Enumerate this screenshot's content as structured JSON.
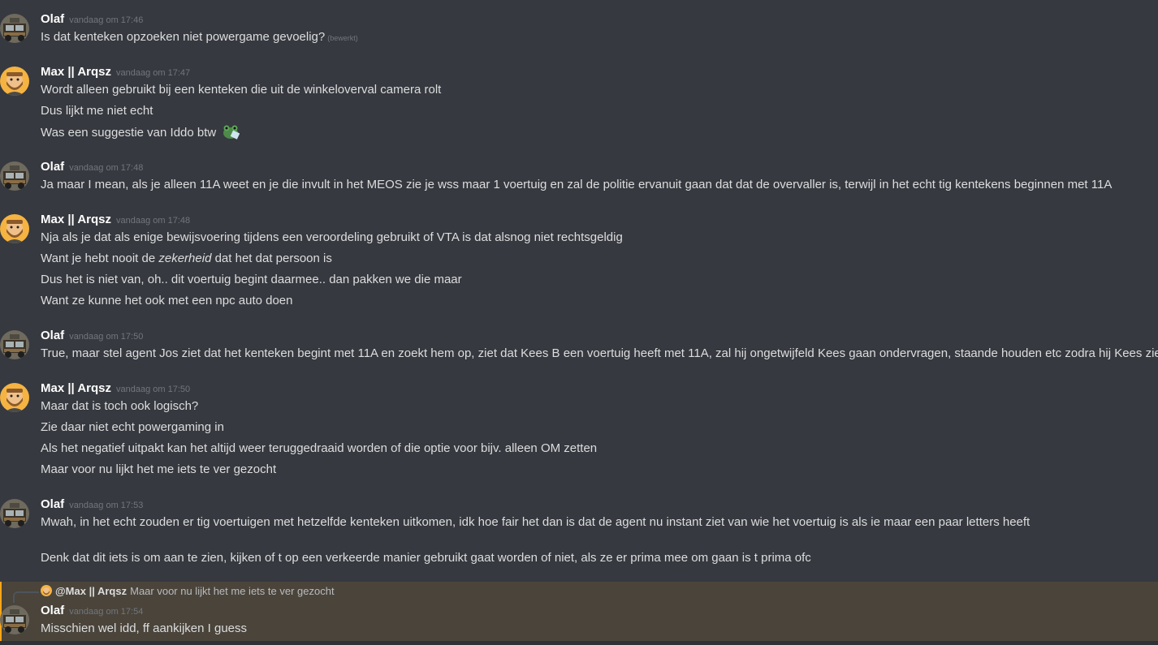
{
  "messages": [
    {
      "author": "Olaf",
      "time": "vandaag om 17:46",
      "lines": [
        "Is dat kenteken opzoeken niet powergame gevoelig?"
      ],
      "edited": "(bewerkt)"
    },
    {
      "author": "Max || Arqsz",
      "time": "vandaag om 17:47",
      "lines": [
        "Wordt alleen gebruikt bij een kenteken die uit de winkeloverval camera rolt",
        "Dus lijkt me niet echt",
        "Was een suggestie van Iddo btw"
      ]
    },
    {
      "author": "Olaf",
      "time": "vandaag om 17:48",
      "lines": [
        "Ja maar I mean, als je alleen 11A weet en je die invult in het MEOS zie je wss maar 1 voertuig en zal de politie ervanuit gaan dat dat de overvaller is, terwijl in het echt tig kentekens beginnen met 11A"
      ]
    },
    {
      "author": "Max || Arqsz",
      "time": "vandaag om 17:48",
      "lines": [
        "Nja als je dat als enige bewijsvoering tijdens een veroordeling gebruikt of VTA is dat alsnog niet rechtsgeldig",
        "dat het dat persoon is",
        "Dus het is niet van, oh.. dit voertuig begint daarmee.. dan pakken we die maar",
        "Want ze kunne het ook met een npc auto doen"
      ],
      "italic_prefix": "Want je hebt nooit de ",
      "italic_word": "zekerheid"
    },
    {
      "author": "Olaf",
      "time": "vandaag om 17:50",
      "lines": [
        "True, maar stel agent Jos ziet dat het kenteken begint met 11A en zoekt hem op, ziet dat Kees B een voertuig heeft met 11A, zal hij ongetwijfeld Kees gaan ondervragen, staande houden etc zodra hij Kees ziet"
      ]
    },
    {
      "author": "Max || Arqsz",
      "time": "vandaag om 17:50",
      "lines": [
        "Maar dat is toch ook logisch?",
        "Zie daar niet echt powergaming in",
        "Als het negatief uitpakt kan het altijd weer teruggedraaid worden of die optie voor bijv. alleen OM zetten",
        "Maar voor nu lijkt het me iets te ver gezocht"
      ]
    },
    {
      "author": "Olaf",
      "time": "vandaag om 17:53",
      "lines": [
        "Mwah, in het echt zouden er tig voertuigen met hetzelfde kenteken uitkomen, idk hoe fair het dan is dat de agent nu instant ziet van wie het voertuig is als ie maar een paar letters heeft",
        "Denk dat dit iets is om aan te zien, kijken of t op een verkeerde manier gebruikt gaat worden of niet, als ze er prima mee om gaan is t prima ofc"
      ]
    },
    {
      "author": "Olaf",
      "time": "vandaag om 17:54",
      "lines": [
        "Misschien wel idd, ff aankijken I guess"
      ]
    }
  ],
  "reply": {
    "author": "@Max || Arqsz",
    "text": "Maar voor nu lijkt het me iets te ver gezocht"
  },
  "icons": {
    "olaf_avatar": "truck-avatar-icon",
    "max_avatar": "bearded-man-avatar-icon",
    "emoji": "frog-emoji-icon"
  },
  "colors": {
    "background": "#36393f",
    "highlight": "#4a443b",
    "mention_bar": "#faa61a",
    "username": "#ffffff",
    "timestamp": "#72767d",
    "text": "#dcddde"
  }
}
